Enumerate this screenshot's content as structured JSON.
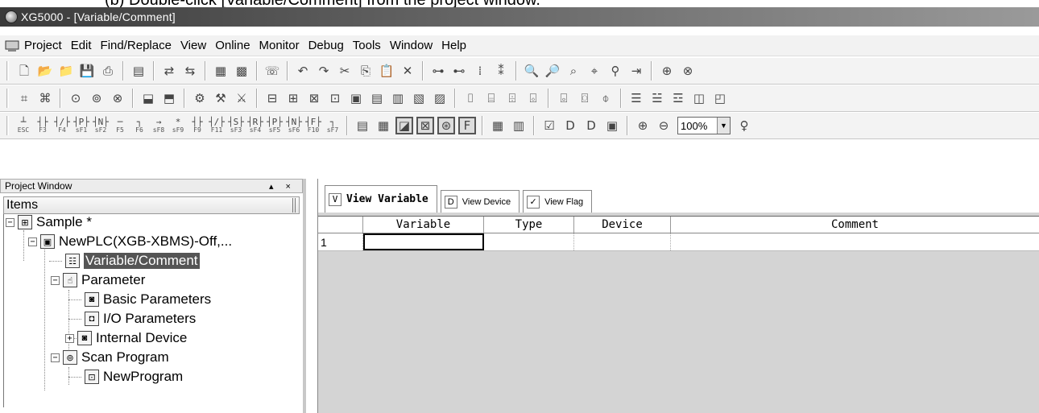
{
  "caption": "(b) Double-click [Variable/Comment] from the project window.",
  "window": {
    "title": "XG5000 - [Variable/Comment]"
  },
  "menu": [
    "Project",
    "Edit",
    "Find/Replace",
    "View",
    "Online",
    "Monitor",
    "Debug",
    "Tools",
    "Window",
    "Help"
  ],
  "fkeys": [
    {
      "sym": "┴",
      "key": "ESC"
    },
    {
      "sym": "┤├",
      "key": "F3"
    },
    {
      "sym": "┤/├",
      "key": "F4"
    },
    {
      "sym": "┤P├",
      "key": "sF1"
    },
    {
      "sym": "┤N├",
      "key": "sF2"
    },
    {
      "sym": "─",
      "key": "F5"
    },
    {
      "sym": "┐",
      "key": "F6"
    },
    {
      "sym": "→",
      "key": "sF8"
    },
    {
      "sym": "*",
      "key": "sF9"
    },
    {
      "sym": "┤├",
      "key": "F9"
    },
    {
      "sym": "┤/├",
      "key": "F11"
    },
    {
      "sym": "┤S├",
      "key": "sF3"
    },
    {
      "sym": "┤R├",
      "key": "sF4"
    },
    {
      "sym": "┤P├",
      "key": "sF5"
    },
    {
      "sym": "┤N├",
      "key": "sF6"
    },
    {
      "sym": "┤F├",
      "key": "F10"
    },
    {
      "sym": "┐",
      "key": "sF7"
    }
  ],
  "zoom": {
    "value": "100%"
  },
  "project_window": {
    "title": "Project Window",
    "controls": "▴ ×",
    "items_header": "Items",
    "tree": {
      "root": "Sample *",
      "plc": "NewPLC(XGB-XBMS)-Off,...",
      "variable_comment": "Variable/Comment",
      "parameter": "Parameter",
      "basic_params": "Basic Parameters",
      "io_params": "I/O Parameters",
      "internal_device": "Internal Device",
      "scan_program": "Scan Program",
      "new_program": "NewProgram"
    }
  },
  "editor": {
    "tabs": [
      {
        "icon": "V",
        "label": "View Variable"
      },
      {
        "icon": "D",
        "label": "View Device"
      },
      {
        "icon": "✓",
        "label": "View Flag"
      }
    ],
    "columns": [
      "Variable",
      "Type",
      "Device",
      "Comment"
    ],
    "rows": [
      {
        "num": "1",
        "variable": "",
        "type": "",
        "device": "",
        "comment": ""
      }
    ]
  }
}
